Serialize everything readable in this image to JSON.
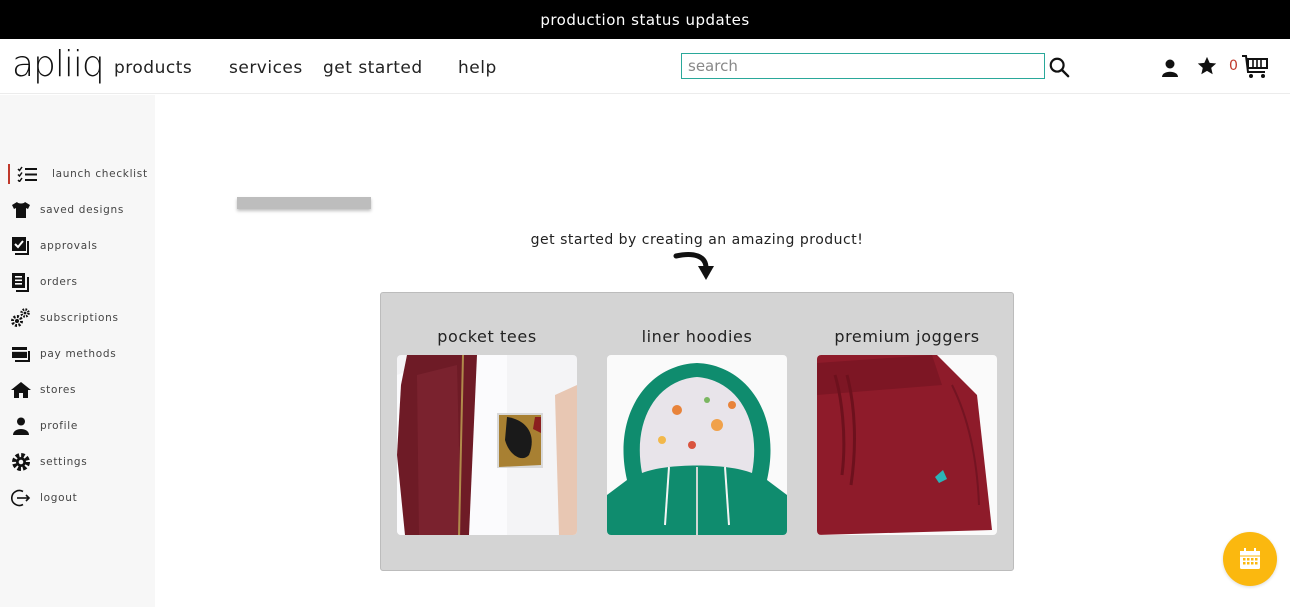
{
  "announcement": {
    "text": "production status updates"
  },
  "header": {
    "logo": "apliiq",
    "nav": [
      {
        "label": "products"
      },
      {
        "label": "services"
      },
      {
        "label": "get started"
      },
      {
        "label": "help"
      }
    ],
    "search": {
      "placeholder": "search",
      "value": ""
    },
    "cart_count": "0"
  },
  "sidebar": {
    "items": [
      {
        "label": "launch checklist",
        "icon": "checklist-icon",
        "active": true
      },
      {
        "label": "saved designs",
        "icon": "tshirt-icon"
      },
      {
        "label": "approvals",
        "icon": "approval-check-icon"
      },
      {
        "label": "orders",
        "icon": "orders-document-icon"
      },
      {
        "label": "subscriptions",
        "icon": "gears-icon"
      },
      {
        "label": "pay methods",
        "icon": "credit-cards-icon"
      },
      {
        "label": "stores",
        "icon": "home-icon"
      },
      {
        "label": "profile",
        "icon": "user-icon"
      },
      {
        "label": "settings",
        "icon": "gear-icon"
      },
      {
        "label": "logout",
        "icon": "logout-icon"
      }
    ]
  },
  "main": {
    "cta": "get started by creating an amazing product!",
    "products": [
      {
        "title": "pocket tees",
        "image": "maroon jacket over white tee with camo pocket"
      },
      {
        "title": "liner hoodies",
        "image": "green hoodie with patterned liner"
      },
      {
        "title": "premium joggers",
        "image": "burgundy joggers with small embroidered patch"
      }
    ]
  },
  "colors": {
    "accent_red": "#c0392b",
    "search_border": "#2aa89a",
    "fab_yellow": "#fbb80f",
    "panel_gray": "#d4d4d4"
  }
}
